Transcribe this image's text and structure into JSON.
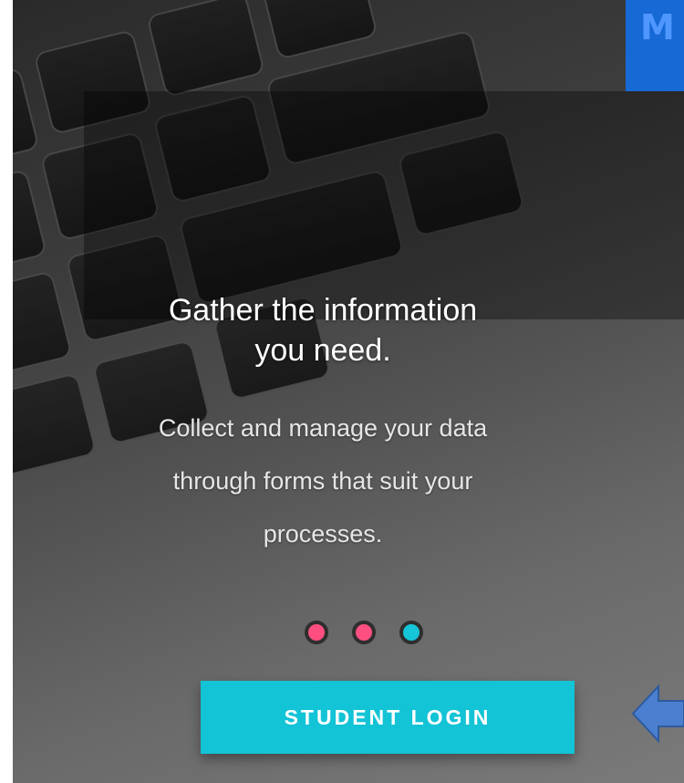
{
  "brand": {
    "label": "M"
  },
  "hero": {
    "headline": "Gather the information you need.",
    "subtext": "Collect and manage your data through forms that suit your processes."
  },
  "carousel": {
    "dots": [
      {
        "color": "#ff4e80",
        "active": false
      },
      {
        "color": "#ff4e80",
        "active": false
      },
      {
        "color": "#16c6d8",
        "active": true
      }
    ]
  },
  "login": {
    "label": "STUDENT LOGIN"
  },
  "annotation": {
    "icon": "left-arrow-icon",
    "color": "#4b7fcf"
  }
}
